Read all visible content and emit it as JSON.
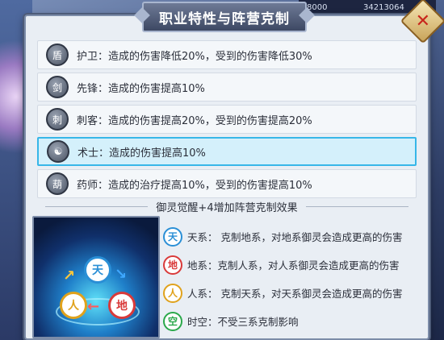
{
  "window": {
    "title": "职业特性与阵营克制"
  },
  "background": {
    "top_value_1": "8000",
    "top_value_2": "34213064"
  },
  "close_button": {
    "icon": "close-icon",
    "glyph": "✕"
  },
  "roles": [
    {
      "name": "护卫",
      "icon": "shield-icon",
      "glyph": "盾",
      "text": "护卫：造成的伤害降低20%，受到的伤害降低30%",
      "selected": false
    },
    {
      "name": "先锋",
      "icon": "sword-icon",
      "glyph": "剑",
      "text": "先锋：造成的伤害提高10%",
      "selected": false
    },
    {
      "name": "刺客",
      "icon": "daggers-icon",
      "glyph": "刺",
      "text": "刺客：造成的伤害提高20%，受到的伤害提高20%",
      "selected": false
    },
    {
      "name": "术士",
      "icon": "yinyang-icon",
      "glyph": "☯",
      "text": "术士：造成的伤害提高10%",
      "selected": true
    },
    {
      "name": "药师",
      "icon": "gourd-icon",
      "glyph": "葫",
      "text": "药师：造成的治疗提高10%，受到的伤害提高10%",
      "selected": false
    }
  ],
  "section_title": "御灵觉醒+4增加阵营克制效果",
  "cycle": {
    "nodes": [
      {
        "label": "天",
        "color": "#2a8fd6"
      },
      {
        "label": "地",
        "color": "#d93a3a"
      },
      {
        "label": "人",
        "color": "#e0a21c"
      }
    ]
  },
  "effects": [
    {
      "badge": "天",
      "color": "#2a8fd6",
      "text": "天系：  克制地系，对地系御灵会造成更高的伤害"
    },
    {
      "badge": "地",
      "color": "#d93a3a",
      "text": "地系：克制人系，对人系御灵会造成更高的伤害"
    },
    {
      "badge": "人",
      "color": "#e0a21c",
      "text": "人系：  克制天系，对天系御灵会造成更高的伤害"
    },
    {
      "badge": "空",
      "color": "#2aa84a",
      "text": "时空：不受三系克制影响"
    }
  ]
}
